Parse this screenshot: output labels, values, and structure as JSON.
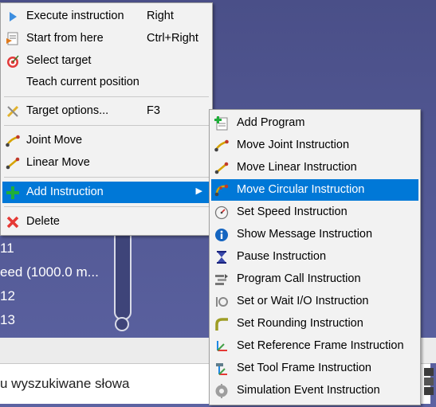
{
  "background": {
    "items": [
      " 11",
      "eed (1000.0 m...",
      " 12",
      " 13"
    ],
    "search_hint": "u wyszukiwane słowa"
  },
  "context_menu": {
    "items": [
      {
        "label": "Execute instruction",
        "shortcut": "Right",
        "icon": "play-icon"
      },
      {
        "label": "Start from here",
        "shortcut": "Ctrl+Right",
        "icon": "start-here-icon"
      },
      {
        "label": "Select target",
        "shortcut": "",
        "icon": "target-icon"
      },
      {
        "label": "Teach current position",
        "shortcut": "",
        "icon": ""
      },
      {
        "label": "Target options...",
        "shortcut": "F3",
        "icon": "target-options-icon"
      },
      {
        "label": "Joint Move",
        "shortcut": "",
        "icon": "joint-move-icon"
      },
      {
        "label": "Linear Move",
        "shortcut": "",
        "icon": "linear-move-icon"
      },
      {
        "label": "Add Instruction",
        "shortcut": "",
        "icon": "plus-icon",
        "submenu_arrow": "▶"
      },
      {
        "label": "Delete",
        "shortcut": "",
        "icon": "delete-icon"
      }
    ],
    "highlighted": "Add Instruction"
  },
  "submenu": {
    "items": [
      {
        "label": "Add Program",
        "icon": "add-program-icon"
      },
      {
        "label": "Move Joint Instruction",
        "icon": "move-joint-icon"
      },
      {
        "label": "Move Linear Instruction",
        "icon": "move-linear-icon"
      },
      {
        "label": "Move Circular Instruction",
        "icon": "move-circular-icon"
      },
      {
        "label": "Set Speed Instruction",
        "icon": "speed-icon"
      },
      {
        "label": "Show Message Instruction",
        "icon": "info-icon"
      },
      {
        "label": "Pause Instruction",
        "icon": "hourglass-icon"
      },
      {
        "label": "Program Call Instruction",
        "icon": "program-call-icon"
      },
      {
        "label": "Set or Wait I/O Instruction",
        "icon": "io-icon"
      },
      {
        "label": "Set Rounding Instruction",
        "icon": "rounding-icon"
      },
      {
        "label": "Set Reference Frame Instruction",
        "icon": "reference-frame-icon"
      },
      {
        "label": "Set Tool Frame Instruction",
        "icon": "tool-frame-icon"
      },
      {
        "label": "Simulation Event Instruction",
        "icon": "simulation-event-icon"
      }
    ],
    "highlighted": "Move Circular Instruction"
  },
  "colors": {
    "highlight": "#0078d7",
    "background": "#545b92",
    "menu": "#f2f2f2"
  }
}
